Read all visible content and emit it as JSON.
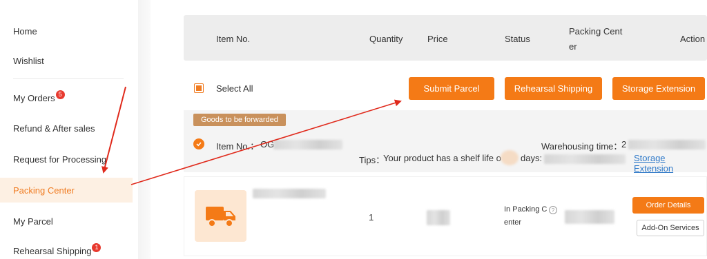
{
  "sidebar": {
    "items": [
      {
        "label": "Home"
      },
      {
        "label": "Wishlist"
      },
      {
        "label": "My Orders",
        "badge": "5"
      },
      {
        "label": "Refund & After sales"
      },
      {
        "label": "Request for Processing"
      },
      {
        "label": "Packing Center"
      },
      {
        "label": "My Parcel"
      },
      {
        "label": "Rehearsal Shipping",
        "badge": "1"
      }
    ]
  },
  "table_header": {
    "item_no": "Item No.",
    "quantity": "Quantity",
    "price": "Price",
    "status": "Status",
    "packing_center_1": "Packing Cent",
    "packing_center_2": "er",
    "action": "Action"
  },
  "toolbar": {
    "select_all": "Select All",
    "submit_parcel": "Submit Parcel",
    "rehearsal_shipping": "Rehearsal Shipping",
    "storage_extension": "Storage Extension"
  },
  "group": {
    "tag": "Goods to be forwarded",
    "item_no_label": "Item No.：",
    "item_no_prefix": "OG",
    "warehousing_label": "Warehousing time：",
    "warehousing_prefix": "2",
    "tips_label": "Tips：",
    "tips_text": "Your product has a shelf life o",
    "tips_text_2": "days:",
    "storage_extension_link": "Storage Extension"
  },
  "item": {
    "quantity": "1",
    "status_1": "In Packing C",
    "status_2": "enter",
    "order_details": "Order Details",
    "add_on_services": "Add-On Services"
  },
  "colors": {
    "accent": "#f47a16",
    "active_bg": "#fdf0e3",
    "badge": "#e83a2f",
    "tag": "#c9915c",
    "link": "#2d78c8",
    "arrow": "#e02a1c"
  }
}
